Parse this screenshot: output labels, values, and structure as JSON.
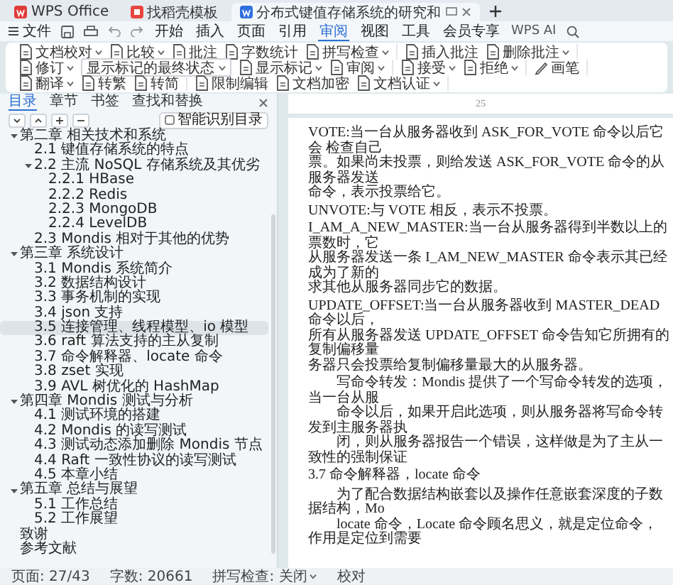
{
  "tabs": [
    {
      "label": "WPS Office",
      "kind": "home",
      "selected": false
    },
    {
      "label": "找稻壳模板",
      "kind": "template",
      "selected": false
    },
    {
      "label": "分布式键值存储系统的研究和",
      "kind": "document",
      "selected": true
    }
  ],
  "menu": {
    "file": "文件",
    "tabs": [
      {
        "label": "开始",
        "selected": false
      },
      {
        "label": "插入",
        "selected": false
      },
      {
        "label": "页面",
        "selected": false
      },
      {
        "label": "引用",
        "selected": false
      },
      {
        "label": "审阅",
        "selected": true
      },
      {
        "label": "视图",
        "selected": false
      },
      {
        "label": "工具",
        "selected": false
      },
      {
        "label": "会员专享",
        "selected": false
      }
    ],
    "ai": "WPS AI"
  },
  "ribbon": {
    "groups": [
      {
        "items": [
          {
            "kind": "button",
            "label": "文档校对",
            "dropdown": true
          },
          {
            "kind": "button",
            "label": "比较",
            "dropdown": true
          },
          {
            "kind": "button",
            "label": "批注",
            "dropdown": false
          },
          {
            "kind": "button",
            "label": "字数统计",
            "dropdown": false
          },
          {
            "kind": "button",
            "label": "拼写检查",
            "dropdown": true
          }
        ]
      },
      {
        "items": [
          {
            "kind": "button",
            "label": "插入批注",
            "dropdown": false
          },
          {
            "kind": "button",
            "label": "删除批注",
            "dropdown": true
          }
        ]
      },
      {
        "items": [
          {
            "kind": "button",
            "label": "修订",
            "dropdown": true
          },
          {
            "kind": "select",
            "label": "显示标记的最终状态",
            "dropdown": true
          },
          {
            "kind": "button",
            "label": "显示标记",
            "dropdown": true
          },
          {
            "kind": "button",
            "label": "审阅",
            "dropdown": true
          }
        ]
      },
      {
        "items": [
          {
            "kind": "button",
            "label": "接受",
            "dropdown": true
          },
          {
            "kind": "button",
            "label": "拒绝",
            "dropdown": true
          }
        ]
      },
      {
        "items": [
          {
            "kind": "button",
            "label": "画笔",
            "dropdown": false
          }
        ]
      },
      {
        "items": [
          {
            "kind": "button",
            "label": "翻译",
            "dropdown": true
          },
          {
            "kind": "button",
            "label": "转繁",
            "dropdown": false
          },
          {
            "kind": "button",
            "label": "转简",
            "dropdown": false
          }
        ]
      },
      {
        "items": [
          {
            "kind": "button",
            "label": "限制编辑",
            "dropdown": false
          },
          {
            "kind": "button",
            "label": "文档加密",
            "dropdown": false
          },
          {
            "kind": "button",
            "label": "文档认证",
            "dropdown": true
          }
        ]
      }
    ]
  },
  "sidebar": {
    "tabs": [
      {
        "label": "目录",
        "selected": true
      },
      {
        "label": "章节",
        "selected": false
      },
      {
        "label": "书签",
        "selected": false
      },
      {
        "label": "查找和替换",
        "selected": false
      }
    ],
    "smart_toc": {
      "label": "智能识别目录",
      "checked": false
    },
    "toc": [
      {
        "label": "第二章 相关技术和系统",
        "selected": false,
        "expanded": true,
        "children": [
          {
            "label": "2.1 键值存储系统的特点",
            "selected": false
          },
          {
            "label": "2.2 主流 NoSQL 存储系统及其优劣",
            "selected": false,
            "expanded": true,
            "children": [
              {
                "label": "2.2.1 HBase",
                "selected": false
              },
              {
                "label": "2.2.2 Redis",
                "selected": false
              },
              {
                "label": "2.2.3 MongoDB",
                "selected": false
              },
              {
                "label": "2.2.4 LevelDB",
                "selected": false
              }
            ]
          },
          {
            "label": "2.3 Mondis 相对于其他的优势",
            "selected": false
          }
        ]
      },
      {
        "label": "第三章 系统设计",
        "selected": false,
        "expanded": true,
        "children": [
          {
            "label": "3.1 Mondis 系统简介",
            "selected": false
          },
          {
            "label": "3.2 数据结构设计",
            "selected": false
          },
          {
            "label": "3.3 事务机制的实现",
            "selected": false
          },
          {
            "label": "3.4 json 支持",
            "selected": false
          },
          {
            "label": "3.5 连接管理、线程模型、io 模型",
            "selected": true
          },
          {
            "label": "3.6 raft 算法支持的主从复制",
            "selected": false
          },
          {
            "label": "3.7 命令解释器、locate 命令",
            "selected": false
          },
          {
            "label": "3.8 zset 实现",
            "selected": false
          },
          {
            "label": "3.9 AVL 树优化的 HashMap",
            "selected": false
          }
        ]
      },
      {
        "label": "第四章 Mondis 测试与分析",
        "selected": false,
        "expanded": true,
        "children": [
          {
            "label": "4.1 测试环境的搭建",
            "selected": false
          },
          {
            "label": "4.2 Mondis 的读写测试",
            "selected": false
          },
          {
            "label": "4.3 测试动态添加删除 Mondis 节点",
            "selected": false
          },
          {
            "label": "4.4 Raft 一致性协议的读写测试",
            "selected": false
          },
          {
            "label": "4.5 本章小结",
            "selected": false
          }
        ]
      },
      {
        "label": "第五章 总结与展望",
        "selected": false,
        "expanded": true,
        "children": [
          {
            "label": "5.1 工作总结",
            "selected": false
          },
          {
            "label": "5.2 工作展望",
            "selected": false
          }
        ]
      },
      {
        "label": "致谢",
        "selected": false
      },
      {
        "label": "参考文献",
        "selected": false
      }
    ]
  },
  "document": {
    "page_number": "25",
    "blocks": [
      {
        "kind": "paragraph",
        "lines": [
          "VOTE:当一台从服务器收到 ASK_FOR_VOTE 命令以后它会 检查自己",
          "票。如果尚未投票，则给发送 ASK_FOR_VOTE 命令的从服务器发送",
          "命令，表示投票给它。"
        ]
      },
      {
        "kind": "paragraph",
        "lines": [
          "UNVOTE:与 VOTE 相反，表示不投票。"
        ]
      },
      {
        "kind": "paragraph",
        "lines": [
          "I_AM_A_NEW_MASTER:当一台从服务器得到半数以上的票数时，它",
          "从服务器发送一条 I_AM_NEW_MASTER 命令表示其已经成为了新的",
          "求其他从服务器同步它的数据。"
        ]
      },
      {
        "kind": "paragraph",
        "lines": [
          "UPDATE_OFFSET:当一台从服务器收到 MASTER_DEAD 命令以后，",
          "所有从服务器发送 UPDATE_OFFSET 命令告知它所拥有的复制偏移量",
          "务器只会投票给复制偏移量最大的从服务器。"
        ]
      },
      {
        "kind": "indented",
        "lines": [
          "写命令转发：Mondis 提供了一个写命令转发的选项，当一台从服",
          "命令以后，如果开启此选项，则从服务器将写命令转发到主服务器执",
          "闭，则从服务器报告一个错误，这样做是为了主从一致性的强制保证"
        ]
      },
      {
        "kind": "heading",
        "lines": [
          "3.7 命令解释器，locate 命令"
        ]
      },
      {
        "kind": "indented",
        "lines": [
          "为了配合数据结构嵌套以及操作任意嵌套深度的子数据结构，Mo",
          "locate 命令，Locate 命令顾名思义，就是定位命令，作用是定位到需要"
        ]
      }
    ]
  },
  "status_bar": [
    {
      "label": "页面: 27/43",
      "dropdown": false
    },
    {
      "label": "字数: 20661",
      "dropdown": false
    },
    {
      "label": "拼写检查: 关闭",
      "dropdown": true
    },
    {
      "label": "校对",
      "dropdown": false
    }
  ]
}
